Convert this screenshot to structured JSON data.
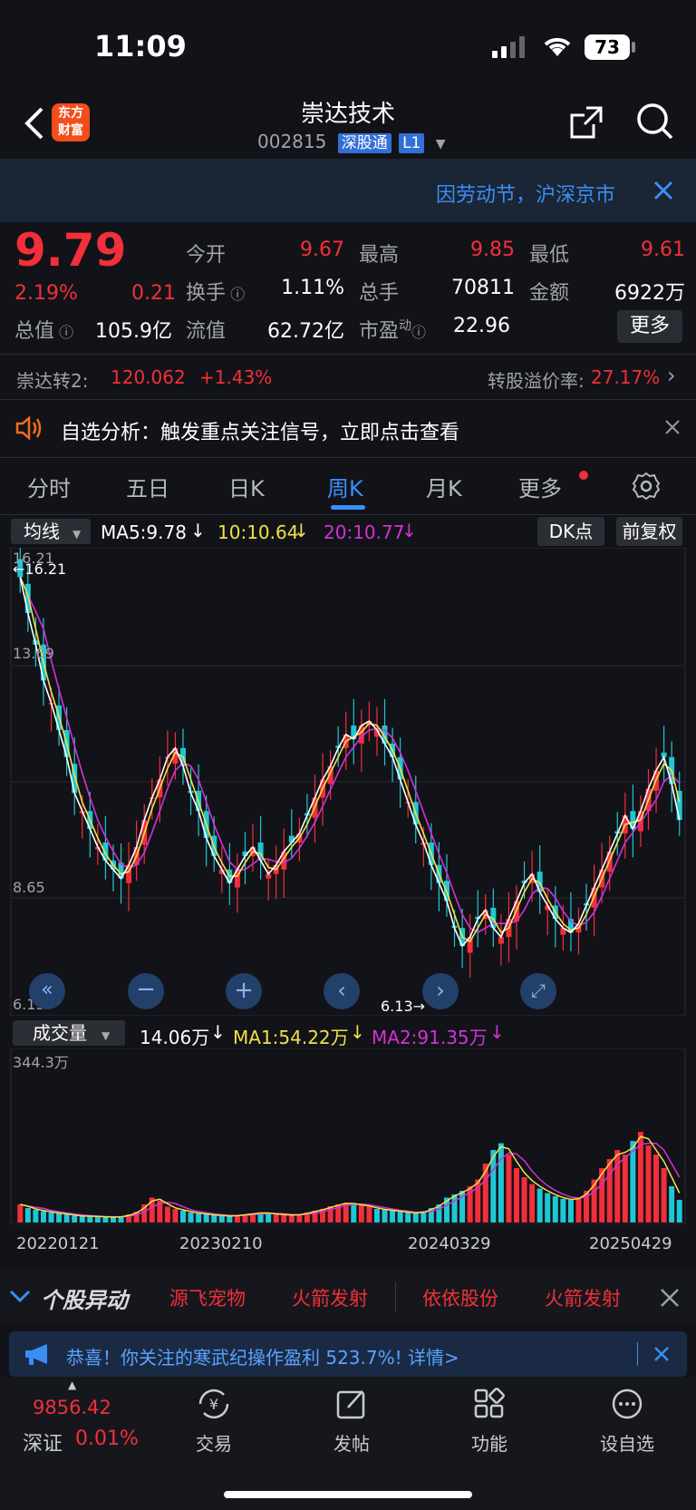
{
  "status_bar": {
    "time": "11:09",
    "battery": "73"
  },
  "nav": {
    "title": "崇达技术",
    "code": "002815",
    "badge1": "深股通",
    "badge2": "L1",
    "logo_line1": "东方",
    "logo_line2": "财富"
  },
  "banner": {
    "text": "因劳动节，沪深京市"
  },
  "quote": {
    "price": "9.79",
    "pct": "2.19%",
    "change": "0.21",
    "fields": {
      "open_label": "今开",
      "open": "9.67",
      "high_label": "最高",
      "high": "9.85",
      "low_label": "最低",
      "low": "9.61",
      "turnover_label": "换手",
      "turnover": "1.11%",
      "volume_label": "总手",
      "volume": "70811",
      "amount_label": "金额",
      "amount": "6922万",
      "mcap_label": "总值",
      "mcap": "105.9亿",
      "float_label": "流值",
      "float": "62.72亿",
      "pe_label": "市盈",
      "pe_sup": "动",
      "pe": "22.96",
      "more": "更多"
    }
  },
  "bond": {
    "name": "崇达转2:",
    "price": "120.062",
    "pct": "+1.43%",
    "premium_label": "转股溢价率:",
    "premium": "27.17%"
  },
  "alert": {
    "text": "自选分析：触发重点关注信号，立即点击查看"
  },
  "tabs": [
    "分时",
    "五日",
    "日K",
    "周K",
    "月K",
    "更多"
  ],
  "ma_bar": {
    "select": "均线",
    "ma5": "MA5:9.78",
    "ma10": "10:10.64",
    "ma20": "20:10.77",
    "dk": "DK点",
    "fq": "前复权"
  },
  "price_chart": {
    "high_label": "16.21",
    "high_mark": "16.21",
    "level1": "13.69",
    "level2": "8.65",
    "low_label": "6.13",
    "low_mark": "6.13"
  },
  "vol_bar": {
    "select": "成交量",
    "vol": "14.06万",
    "ma1": "MA1:54.22万",
    "ma2": "MA2:91.35万",
    "max": "344.3万"
  },
  "dates": [
    "20220121",
    "20230210",
    "20240329",
    "20250429"
  ],
  "movers": {
    "title": "个股异动",
    "items": [
      "源飞宠物",
      "火箭发射",
      "依依股份",
      "火箭发射"
    ]
  },
  "promo": {
    "text": "恭喜！你关注的寒武纪操作盈利 523.7%! 详情>"
  },
  "bottom_nav": {
    "index_value": "9856.42",
    "index_name": "深证",
    "index_pct": "0.01%",
    "items": [
      "交易",
      "发帖",
      "功能",
      "设自选"
    ]
  },
  "colors": {
    "up": "#f22f3a",
    "down": "#1fc7d4",
    "ma5": "#ffffff",
    "ma10": "#f2e04a",
    "ma20": "#d331d6",
    "accent": "#3a8ef5"
  },
  "chart_data": {
    "type": "candlestick-weekly",
    "y_range": [
      6.13,
      16.21
    ],
    "labels": [
      "16.21",
      "13.69",
      "8.65",
      "6.13"
    ],
    "x_ticks": [
      "20220121",
      "20230210",
      "20240329",
      "20250429"
    ],
    "close_series": [
      15.8,
      15.0,
      14.3,
      13.5,
      13.0,
      12.4,
      11.8,
      11.0,
      10.6,
      10.2,
      9.8,
      9.5,
      9.3,
      9.1,
      9.4,
      9.8,
      10.4,
      10.9,
      11.3,
      11.8,
      12.0,
      11.6,
      11.0,
      10.6,
      10.0,
      9.6,
      9.3,
      9.0,
      9.3,
      9.6,
      9.8,
      9.5,
      9.2,
      9.4,
      9.7,
      9.9,
      10.1,
      10.5,
      10.9,
      11.3,
      11.6,
      12.0,
      12.3,
      12.2,
      12.5,
      12.6,
      12.4,
      12.1,
      11.8,
      11.3,
      10.8,
      10.3,
      9.9,
      9.4,
      9.0,
      8.6,
      8.0,
      7.6,
      7.8,
      8.2,
      8.4,
      8.0,
      7.8,
      8.2,
      8.6,
      9.0,
      9.2,
      8.8,
      8.5,
      8.2,
      8.0,
      7.9,
      8.1,
      8.5,
      8.9,
      9.3,
      9.7,
      10.1,
      10.5,
      10.2,
      10.6,
      11.1,
      11.5,
      11.8,
      11.2,
      10.4
    ],
    "volume_series": [
      40,
      32,
      28,
      25,
      22,
      20,
      18,
      15,
      14,
      14,
      13,
      12,
      12,
      13,
      18,
      24,
      40,
      55,
      48,
      35,
      30,
      26,
      22,
      20,
      18,
      16,
      15,
      14,
      16,
      18,
      20,
      22,
      20,
      18,
      17,
      16,
      18,
      22,
      26,
      30,
      36,
      40,
      44,
      40,
      38,
      35,
      30,
      28,
      26,
      24,
      22,
      20,
      25,
      32,
      40,
      55,
      62,
      70,
      80,
      95,
      130,
      160,
      175,
      150,
      120,
      100,
      85,
      75,
      65,
      58,
      52,
      50,
      55,
      70,
      95,
      120,
      140,
      160,
      150,
      180,
      200,
      170,
      150,
      120,
      80,
      50
    ]
  }
}
